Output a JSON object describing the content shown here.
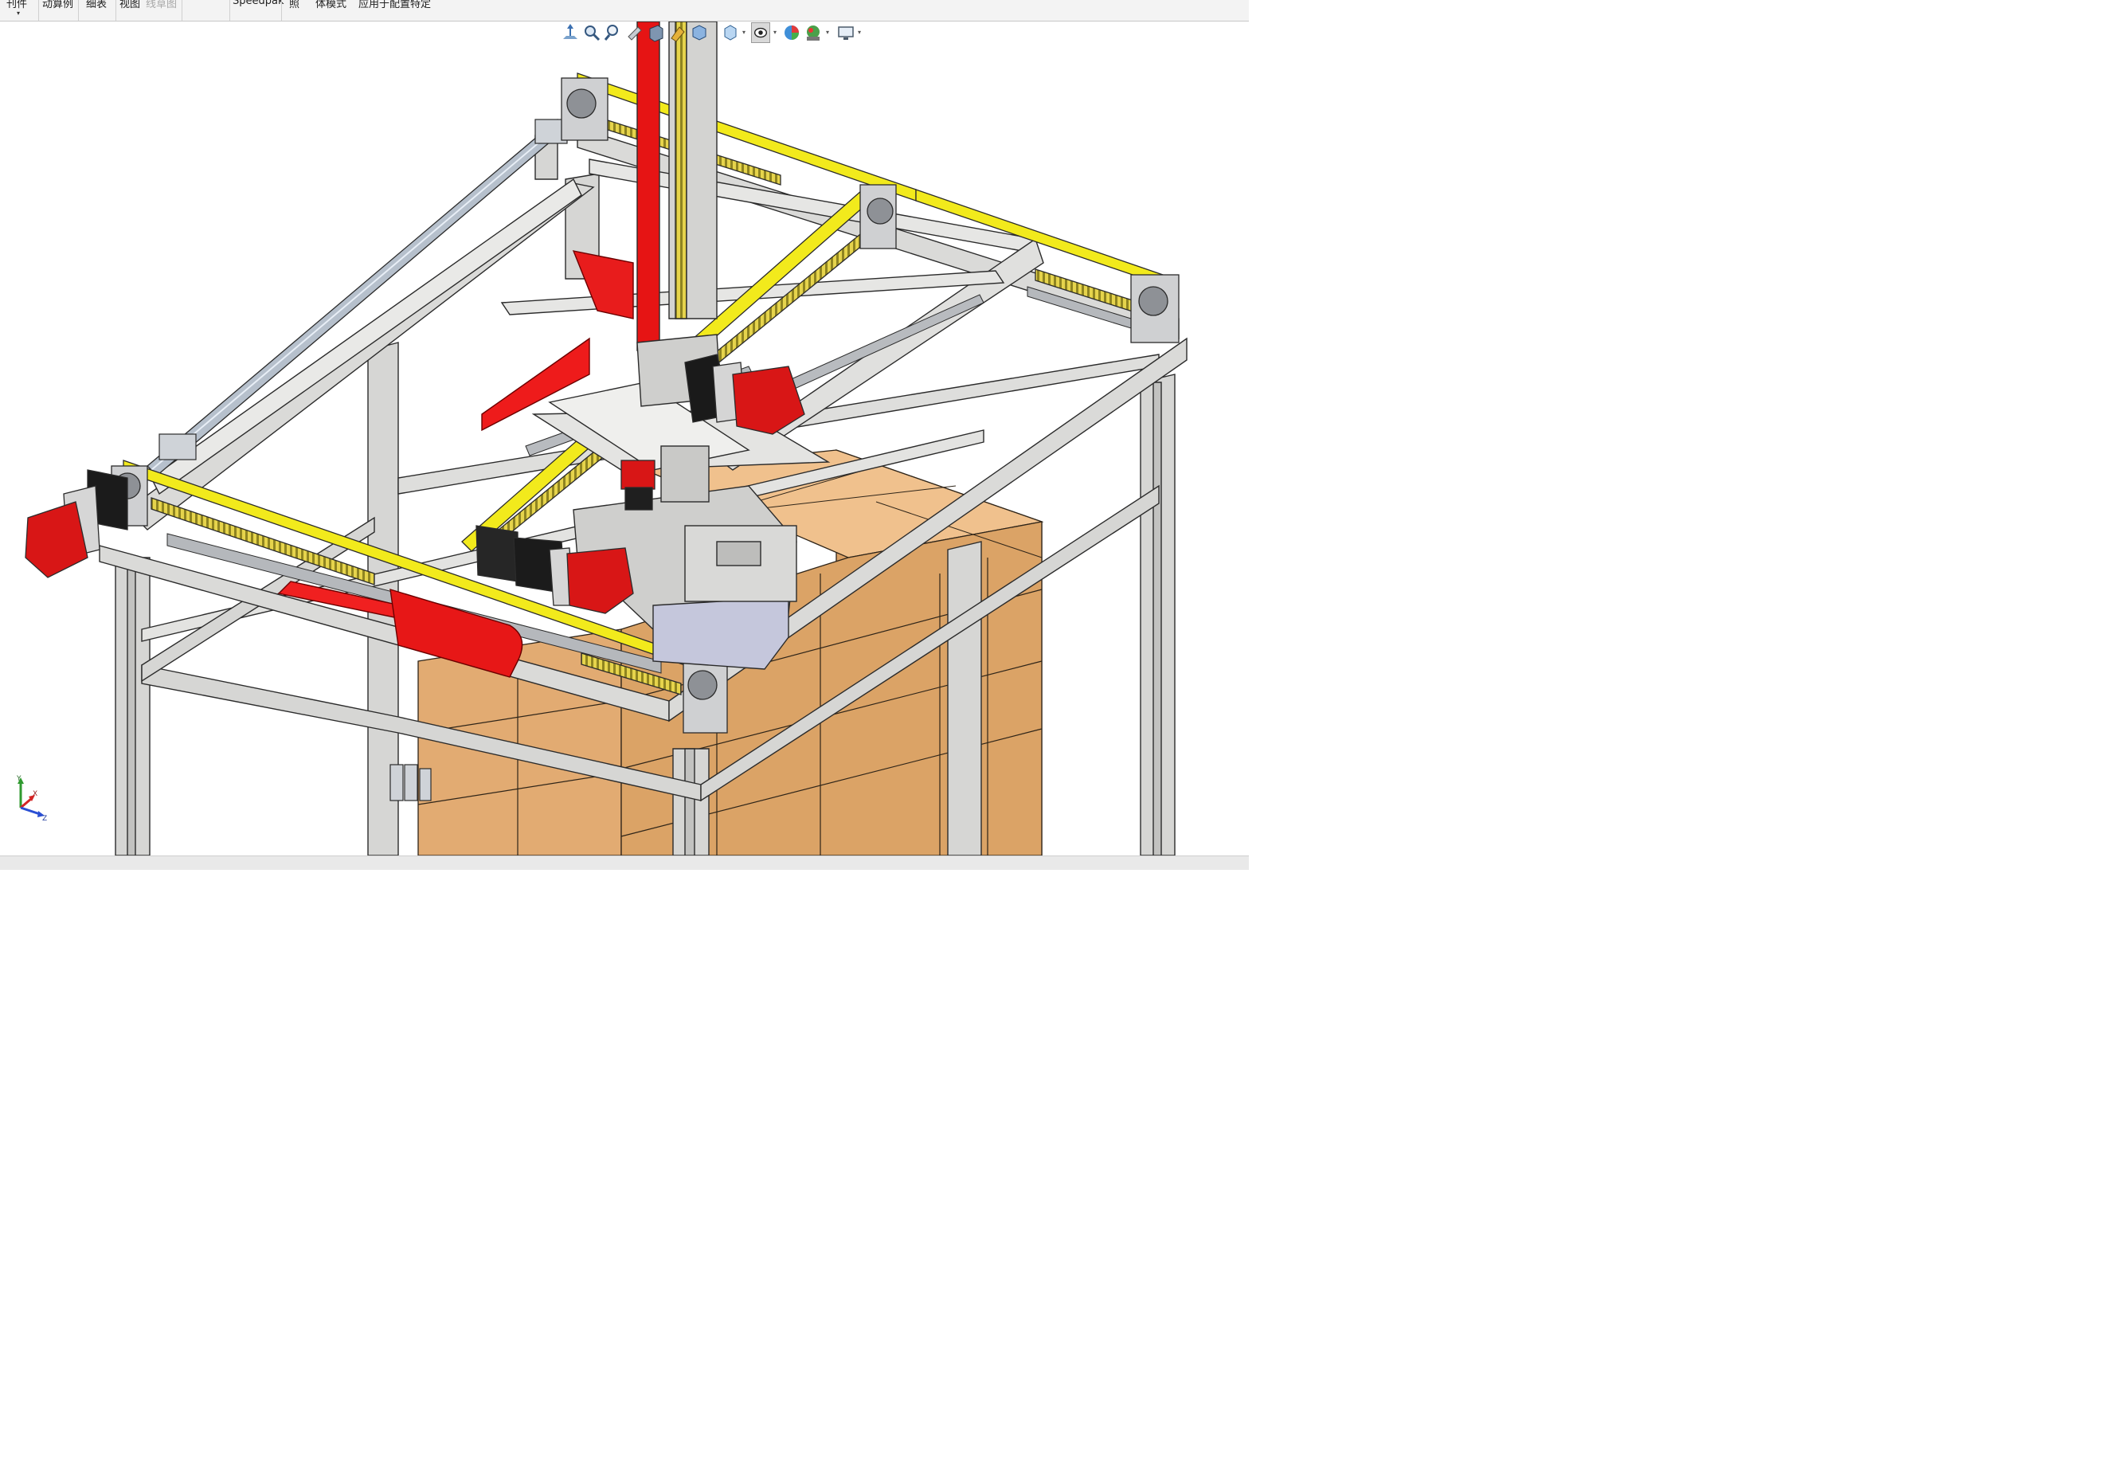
{
  "ribbon": {
    "items": [
      {
        "label": "刊件",
        "dim": false
      },
      {
        "label": "动算例",
        "dim": false
      },
      {
        "label": "细表",
        "dim": false
      },
      {
        "label": "视图",
        "dim": false
      },
      {
        "label": "线草图",
        "dim": true
      },
      {
        "label": "Speedpak",
        "dim": false
      },
      {
        "label": "照",
        "dim": false
      },
      {
        "label": "体模式",
        "dim": false
      },
      {
        "label": "应用于配置特定",
        "dim": false
      }
    ]
  },
  "view_toolbar": {
    "tools": [
      {
        "name": "view-orientation-icon"
      },
      {
        "name": "zoom-to-fit-icon"
      },
      {
        "name": "zoom-to-area-icon"
      },
      {
        "name": "previous-view-icon"
      },
      {
        "name": "section-view-icon"
      },
      {
        "name": "dynamic-annotation-icon"
      },
      {
        "name": "view-cube-icon"
      },
      {
        "name": "display-style-icon"
      },
      {
        "name": "hide-show-items-icon"
      },
      {
        "name": "edit-appearance-icon"
      },
      {
        "name": "apply-scene-icon"
      },
      {
        "name": "view-settings-icon"
      }
    ]
  },
  "triad": {
    "x_label": "X",
    "y_label": "Y",
    "z_label": "Z"
  },
  "colors": {
    "frame": "#d6d6d4",
    "frame_edge": "#2b2b2b",
    "belt": "#f2ea1c",
    "rack": "#e3d24a",
    "motor_red": "#d81616",
    "cable_chain": "#ee1b1b",
    "carton": "#e9b47b",
    "carton_dark": "#c8915c",
    "steel": "#a9adb3"
  }
}
